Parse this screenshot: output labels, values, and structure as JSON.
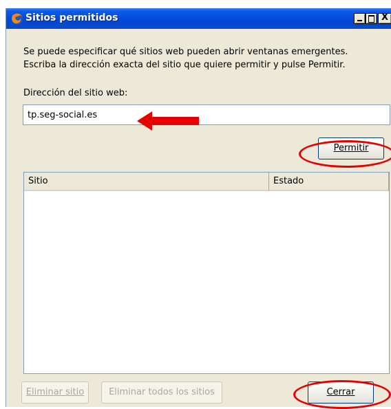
{
  "window": {
    "title": "Sitios permitidos",
    "controls": [
      "minimize",
      "maximize",
      "close"
    ],
    "close_glyph": "X"
  },
  "description": {
    "line1": "Se puede especificar qué sitios web pueden abrir ventanas emergentes.",
    "line2": "Escriba la dirección exacta del sitio que quiere permitir y pulse Permitir."
  },
  "address": {
    "label": "Dirección del sitio web:",
    "value": "tp.seg-social.es"
  },
  "buttons": {
    "allow_label": "Permitir",
    "remove_site_label": "Eliminar sitio",
    "remove_all_label": "Eliminar todos los sitios",
    "close_label": "Cerrar"
  },
  "table": {
    "columns": [
      "Sitio",
      "Estado"
    ],
    "rows": []
  },
  "annotations": {
    "color": "#e60000",
    "arrow_target": "address-input",
    "circled": [
      "Permitir",
      "Cerrar"
    ]
  },
  "icons": {
    "app": "firefox-icon"
  }
}
